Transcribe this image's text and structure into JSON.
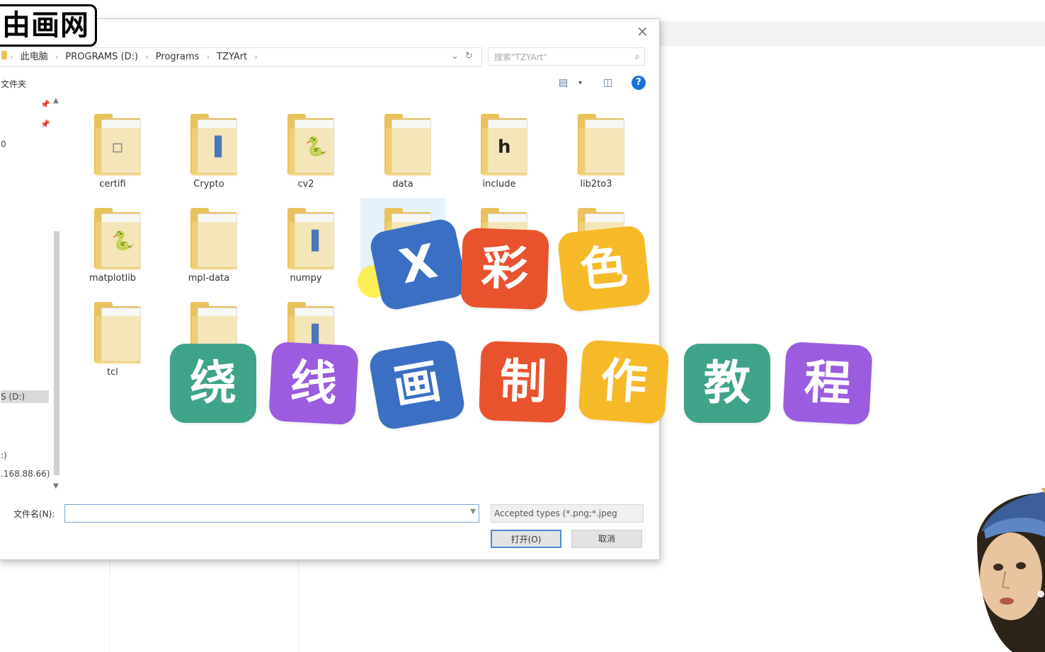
{
  "watermark": {
    "logo_text": "由画网"
  },
  "dialog": {
    "close_label": "×",
    "address": {
      "crumbs": [
        "此电脑",
        "PROGRAMS (D:)",
        "Programs",
        "TZYArt"
      ],
      "separator": "›",
      "dropdown": "⌄",
      "refresh": "↻"
    },
    "search": {
      "placeholder": "搜索\"TZYArt\"",
      "icon": "⌕"
    },
    "toolbar": {
      "new_folder": "文件夹",
      "view_icon": "▤",
      "view_arrow": "▾",
      "pane_icon": "◫",
      "help": "?"
    },
    "nav": {
      "items": [
        {
          "label": "0"
        },
        {
          "label": "S (D:)"
        },
        {
          "label": ":)"
        },
        {
          "label": ".168.88.66)"
        }
      ],
      "pin": "📌"
    },
    "files": [
      {
        "name": "certifi",
        "glyph": "▫",
        "glyph_color": "#888888"
      },
      {
        "name": "Crypto",
        "glyph": "▐",
        "glyph_color": "#4a77b8"
      },
      {
        "name": "cv2",
        "glyph": "🐍",
        "glyph_color": "#3d78b5"
      },
      {
        "name": "data",
        "glyph": "",
        "glyph_color": "#888888"
      },
      {
        "name": "include",
        "glyph": "h",
        "glyph_color": "#222222"
      },
      {
        "name": "lib2to3",
        "glyph": "",
        "glyph_color": "#888888"
      },
      {
        "name": "matplotlib",
        "glyph": "🐍",
        "glyph_color": "#3d78b5"
      },
      {
        "name": "mpl-data",
        "glyph": "",
        "glyph_color": "#888888"
      },
      {
        "name": "numpy",
        "glyph": "▐",
        "glyph_color": "#4a77b8"
      },
      {
        "name": "",
        "glyph": "",
        "glyph_color": "#888888"
      },
      {
        "name": "",
        "glyph": "",
        "glyph_color": "#888888"
      },
      {
        "name": "",
        "glyph": "",
        "glyph_color": "#888888"
      },
      {
        "name": "tcl",
        "glyph": "",
        "glyph_color": "#888888"
      },
      {
        "name": "",
        "glyph": "",
        "glyph_color": "#888888"
      },
      {
        "name": "",
        "glyph": "▐",
        "glyph_color": "#4a77b8"
      }
    ],
    "filename": {
      "label": "文件名(N):",
      "value": ""
    },
    "file_type": {
      "selected": "Accepted types (*.png;*.jpeg"
    },
    "buttons": {
      "open": "打开(O)",
      "cancel": "取消"
    }
  },
  "overlay_title": {
    "stickers": [
      {
        "text": "X",
        "color": "#3a6fc4"
      },
      {
        "text": "彩",
        "color": "#e8532e"
      },
      {
        "text": "色",
        "color": "#f6b928"
      },
      {
        "text": "绕",
        "color": "#3fa38a"
      },
      {
        "text": "线",
        "color": "#9b5ce0"
      },
      {
        "text": "画",
        "color": "#3a6fc4"
      },
      {
        "text": "制",
        "color": "#e8532e"
      },
      {
        "text": "作",
        "color": "#f6b928"
      },
      {
        "text": "教",
        "color": "#3fa38a"
      },
      {
        "text": "程",
        "color": "#9b5ce0"
      }
    ]
  }
}
